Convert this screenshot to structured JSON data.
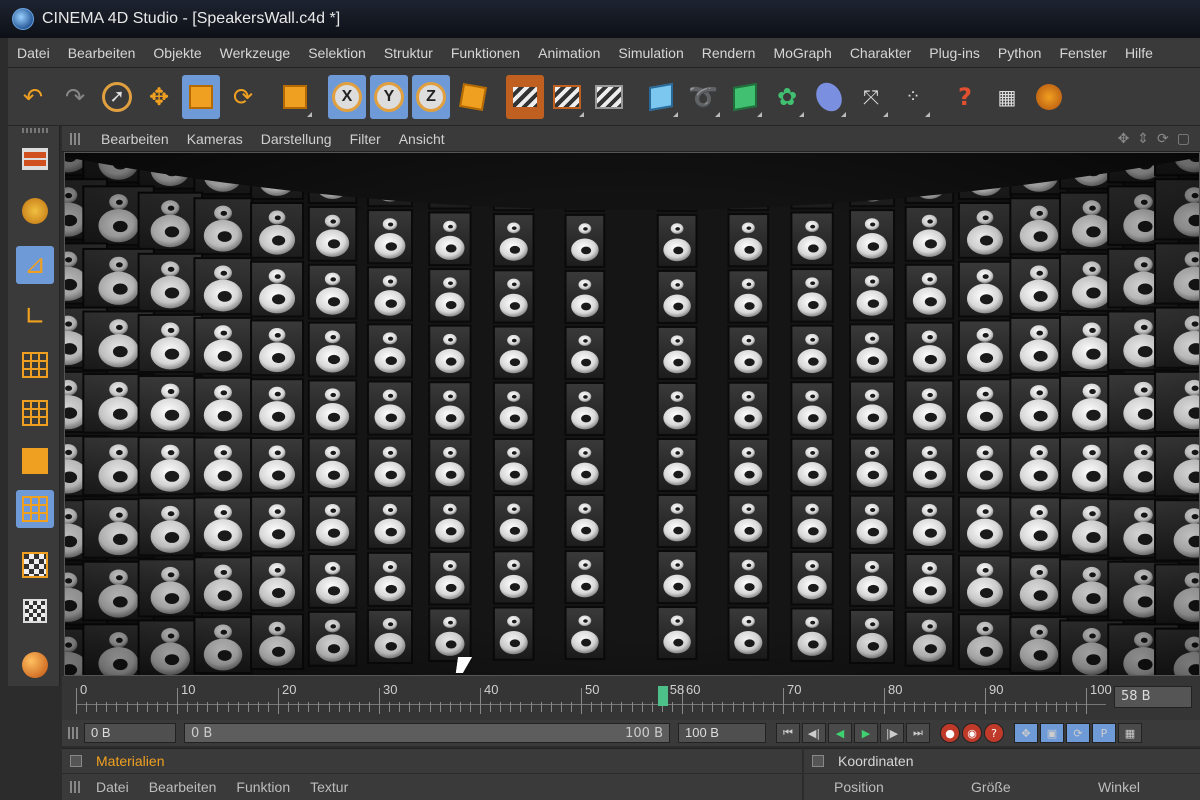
{
  "window": {
    "title": "CINEMA 4D Studio - [SpeakersWall.c4d *]"
  },
  "menubar": [
    "Datei",
    "Bearbeiten",
    "Objekte",
    "Werkzeuge",
    "Selektion",
    "Struktur",
    "Funktionen",
    "Animation",
    "Simulation",
    "Rendern",
    "MoGraph",
    "Charakter",
    "Plug-ins",
    "Python",
    "Fenster",
    "Hilfe"
  ],
  "toolbar": {
    "axis_x": "X",
    "axis_y": "Y",
    "axis_z": "Z",
    "icons": [
      "undo-icon",
      "redo-icon",
      "live-selection-icon",
      "move-icon",
      "scale-icon",
      "rotate-icon",
      "recent-tool-icon",
      "x-axis-icon",
      "y-axis-icon",
      "z-axis-icon",
      "coordinate-system-icon",
      "render-view-icon",
      "render-picture-viewer-icon",
      "render-settings-icon",
      "cube-icon",
      "spline-icon",
      "nurbs-icon",
      "array-icon",
      "deformer-icon",
      "scene-icon",
      "mograph-icon",
      "help-icon",
      "layout-icon",
      "globe-icon"
    ]
  },
  "viewport": {
    "menu": [
      "Bearbeiten",
      "Kameras",
      "Darstellung",
      "Filter",
      "Ansicht"
    ],
    "nav_icons": [
      "✥",
      "⇕",
      "⟳",
      "▢"
    ],
    "scene": "speaker-wall"
  },
  "timeline": {
    "ticks": [
      "0",
      "10",
      "20",
      "30",
      "40",
      "50",
      "60",
      "70",
      "80",
      "90",
      "100"
    ],
    "current_frame": "58 B",
    "playhead_label": "58",
    "playhead_frame": 58,
    "max_frame": 100
  },
  "controls": {
    "start": "0 B",
    "range_start": "0 B",
    "range_end": "100 B",
    "end": "100 B"
  },
  "materials": {
    "title": "Materialien",
    "menu": [
      "Datei",
      "Bearbeiten",
      "Funktion",
      "Textur"
    ]
  },
  "coords": {
    "title": "Koordinaten",
    "columns": [
      "Position",
      "Größe",
      "Winkel"
    ]
  }
}
